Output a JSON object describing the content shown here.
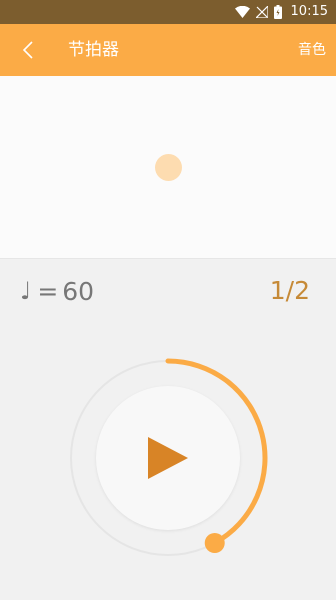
{
  "status_bar": {
    "time": "10:15",
    "icons": [
      "wifi-icon",
      "no-signal-icon",
      "battery-icon"
    ]
  },
  "app_bar": {
    "title": "节拍器",
    "tone_label": "音色",
    "back_icon": "chevron-left-icon"
  },
  "tempo": {
    "note_symbol": "♩",
    "equals": "=",
    "bpm": "60"
  },
  "beats": "1/2",
  "dial": {
    "progress": 0.42,
    "icon": "play-icon"
  },
  "colors": {
    "accent": "#fbab46",
    "status_bar": "#7c5d2e",
    "beat_dot": "#fddcb0",
    "play": "#d88426",
    "beats_text": "#c68a37"
  }
}
